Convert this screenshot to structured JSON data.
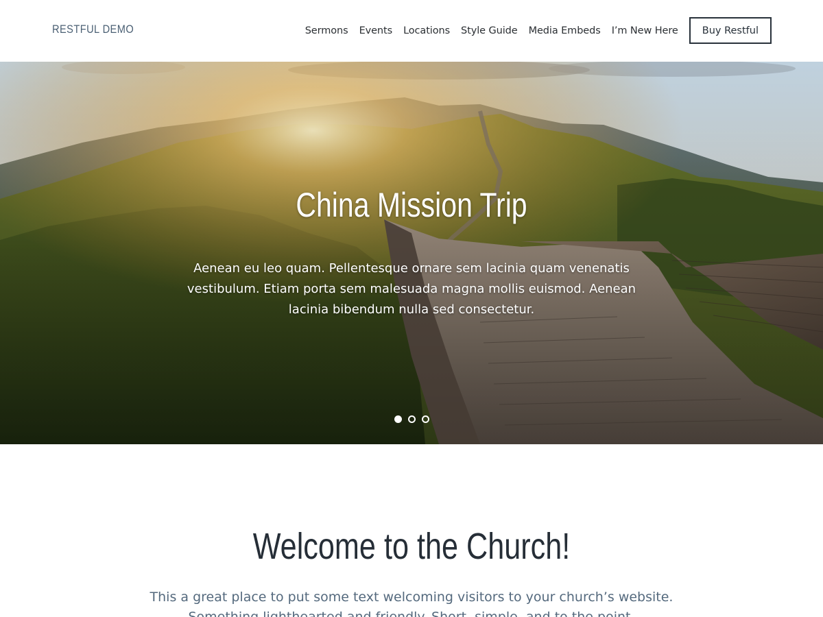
{
  "header": {
    "logo": "RESTFUL DEMO",
    "nav": [
      "Sermons",
      "Events",
      "Locations",
      "Style Guide",
      "Media Embeds",
      "I’m New Here"
    ],
    "cta": "Buy Restful"
  },
  "hero": {
    "title": "China Mission Trip",
    "text": "Aenean eu leo quam. Pellentesque ornare sem lacinia quam venenatis vestibulum. Etiam porta sem malesuada magna mollis euismod. Aenean lacinia bibendum nulla sed consectetur.",
    "slides": 3,
    "active_slide": 1
  },
  "welcome": {
    "title": "Welcome to the Church!",
    "text": "This a great place to put some text welcoming visitors to your church’s website. Something lighthearted and friendly. Short, simple, and to the point."
  }
}
